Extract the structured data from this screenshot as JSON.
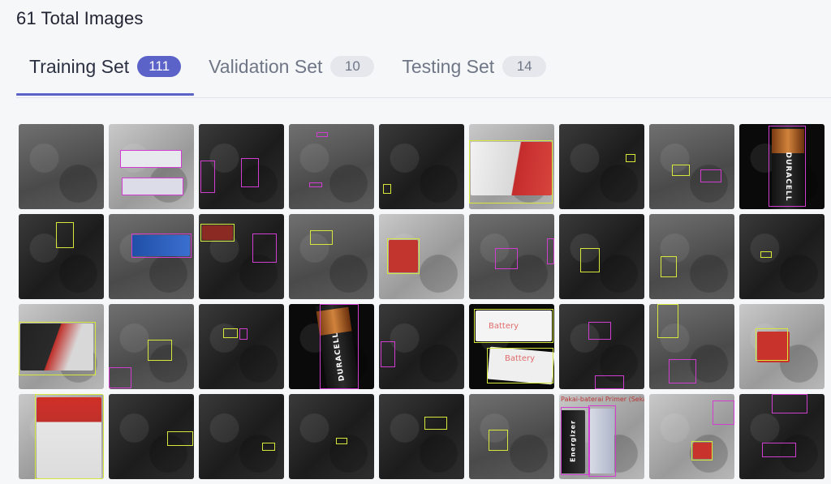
{
  "header": {
    "title": "61 Total Images"
  },
  "tabs": [
    {
      "label": "Training Set",
      "count": "111",
      "active": true
    },
    {
      "label": "Validation Set",
      "count": "10",
      "active": false
    },
    {
      "label": "Testing Set",
      "count": "14",
      "active": false
    }
  ],
  "colors": {
    "accent": "#5b63c9",
    "box_yellow": "#d7e83a",
    "box_magenta": "#d13cd3"
  },
  "thumbnail_text": {
    "duracell": "DURACELL",
    "duracell_2": "DURACELL",
    "battery": "Battery",
    "battery_2": "Battery",
    "energizer": "Energizer",
    "batteries_sign": "Pakai-baterai Primer (Sekali Pakai)"
  }
}
